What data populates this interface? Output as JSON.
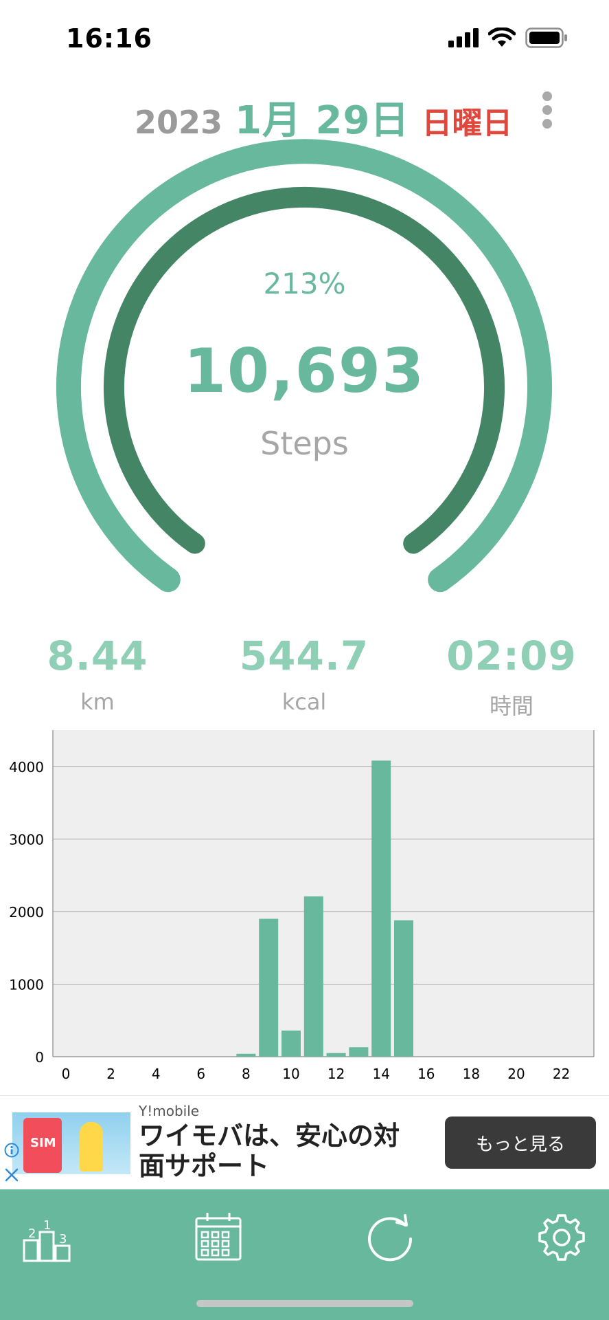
{
  "status_bar": {
    "time": "16:16"
  },
  "header": {
    "year": "2023",
    "month_day": "1月 29日",
    "weekday": "日曜日"
  },
  "gauge": {
    "percent": "213%",
    "steps": "10,693",
    "unit": "Steps"
  },
  "stats": [
    {
      "value": "8.44",
      "unit": "km"
    },
    {
      "value": "544.7",
      "unit": "kcal"
    },
    {
      "value": "02:09",
      "unit": "時間"
    }
  ],
  "chart_data": {
    "type": "bar",
    "x": [
      0,
      1,
      2,
      3,
      4,
      5,
      6,
      7,
      8,
      9,
      10,
      11,
      12,
      13,
      14,
      15,
      16,
      17,
      18,
      19,
      20,
      21,
      22,
      23
    ],
    "values": [
      0,
      0,
      0,
      0,
      0,
      0,
      0,
      0,
      40,
      1900,
      360,
      2210,
      50,
      130,
      4080,
      1880,
      0,
      0,
      0,
      0,
      0,
      0,
      0,
      0
    ],
    "x_ticks": [
      "0",
      "2",
      "4",
      "6",
      "8",
      "10",
      "12",
      "14",
      "16",
      "18",
      "20",
      "22"
    ],
    "y_ticks": [
      "0",
      "1000",
      "2000",
      "3000",
      "4000"
    ],
    "ylim": [
      0,
      4500
    ],
    "grid": true,
    "bar_color": "#67b89c"
  },
  "ad": {
    "brand": "Y!mobile",
    "headline": "ワイモバは、安心の対面サポート",
    "cta": "もっと見る",
    "image_text": "SIM"
  },
  "colors": {
    "accent": "#67b89c",
    "accent_dark": "#438564",
    "weekday": "#e0473d",
    "tabbar": "#67b89c"
  },
  "tabbar": {
    "icons": [
      "ranking-icon",
      "calendar-icon",
      "refresh-icon",
      "gear-icon"
    ]
  }
}
